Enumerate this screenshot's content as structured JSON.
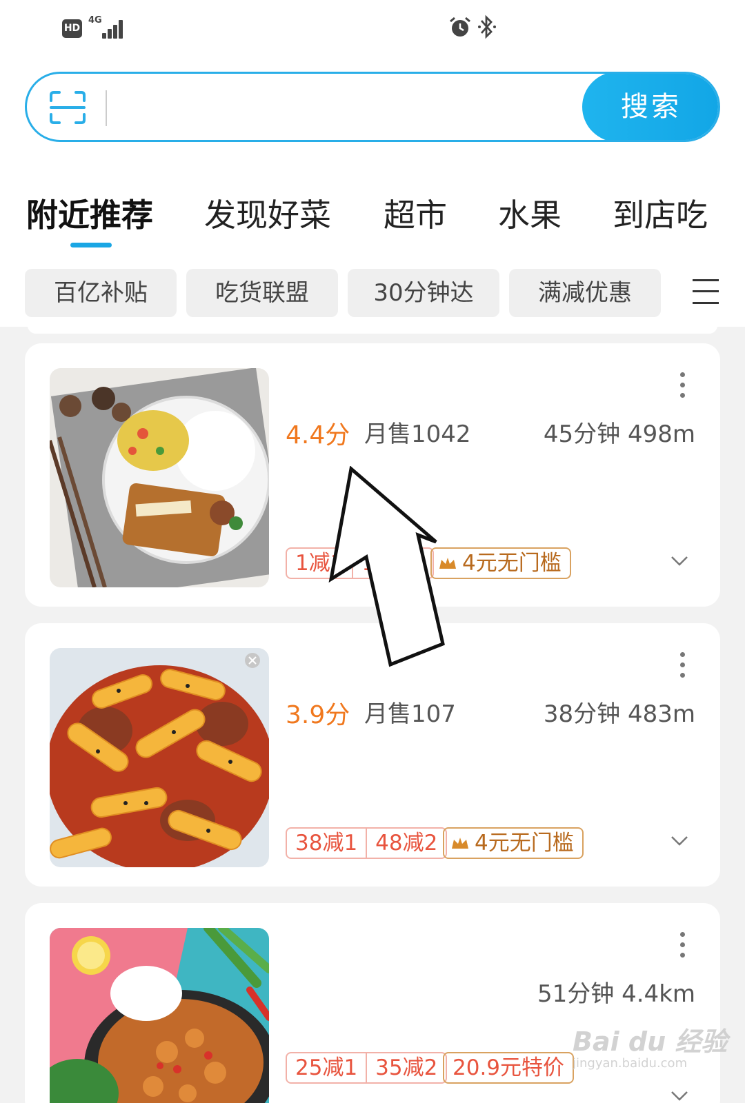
{
  "status_bar": {
    "hd": "HD",
    "network": "4G"
  },
  "search": {
    "button_label": "搜索",
    "placeholder": ""
  },
  "tabs": [
    "附近推荐",
    "发现好菜",
    "超市",
    "水果",
    "到店吃"
  ],
  "active_tab": "附近推荐",
  "filters": [
    "百亿补贴",
    "吃货联盟",
    "30分钟达",
    "满减优惠"
  ],
  "stores": [
    {
      "rating": "4.4分",
      "monthly_sales": "月售1042",
      "eta_distance": "45分钟 498m",
      "promos": [
        "1减1",
        "14减3"
      ],
      "coupon": "4元无门槛",
      "image": "chicken-cutlet-rice-plate"
    },
    {
      "rating": "3.9分",
      "monthly_sales": "月售107",
      "eta_distance": "38分钟 483m",
      "promos": [
        "38减1",
        "48减2"
      ],
      "coupon": "4元无门槛",
      "image": "tteokbokki-dish"
    },
    {
      "rating": "",
      "monthly_sales": "",
      "eta_distance": "51分钟 4.4km",
      "promos": [
        "25减1",
        "35减2"
      ],
      "coupon": "20.9元特价",
      "image": "braised-chicken-rice-pot"
    }
  ],
  "watermark": {
    "brand": "Bai du 经验",
    "url": "jingyan.baidu.com"
  },
  "colors": {
    "accent": "#1aa6e4",
    "rating": "#f0781e",
    "promo": "#e8543e",
    "coupon": "#b86a1e"
  }
}
